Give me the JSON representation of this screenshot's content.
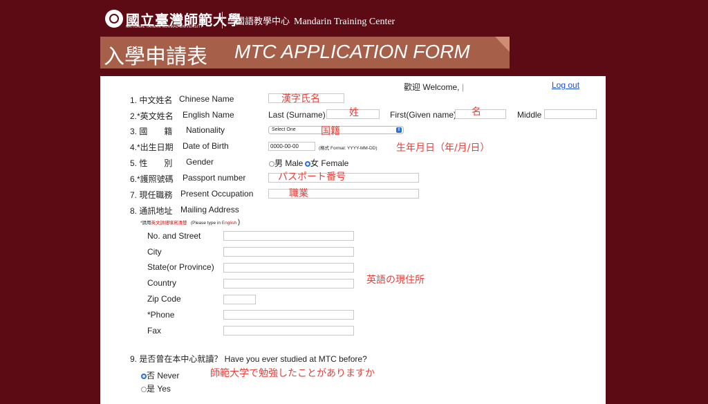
{
  "header": {
    "university_cn": "國立臺灣師範大學",
    "university_en": "NATIONAL TAIWAN NORMAL UNIVERSITY",
    "center_cn": "國語教學中心",
    "center_en": "Mandarin Training Center"
  },
  "banner": {
    "title_cn": "入學申請表",
    "title_en": "MTC APPLICATION FORM"
  },
  "topbar": {
    "welcome": "歡迎 Welcome,",
    "welcome_user": "",
    "logout": "Log out"
  },
  "form": {
    "f1": {
      "label_cn": "1. 中文姓名",
      "label_en": "Chinese Name",
      "value": "",
      "note": "漢字氏名"
    },
    "f2": {
      "label_cn": "2.*英文姓名",
      "label_en": "English Name",
      "last_label": "Last (Surname)",
      "last_value": "",
      "last_note": "姓",
      "first_label": "First(Given name)",
      "first_value": "",
      "first_note": "名",
      "middle_label": "Middle",
      "middle_value": ""
    },
    "f3": {
      "label_cn": "3. 國　　籍",
      "label_en": "Nationality",
      "selected": "Select One",
      "note": "国籍"
    },
    "f4": {
      "label_cn": "4.*出生日期",
      "label_en": "Date of Birth",
      "value": "0000-00-00",
      "format_hint": "(格式 Format: YYYY-MM-DD)",
      "note": "生年月日（年/月/日）"
    },
    "f5": {
      "label_cn": "5. 性　　別",
      "label_en": "Gender",
      "male": "男 Male",
      "female": "女 Female",
      "selected": "female"
    },
    "f6": {
      "label_cn": "6.*護照號碼",
      "label_en": "Passport number",
      "value": "",
      "note": "パスポート番号"
    },
    "f7": {
      "label_cn": "7. 現任職務",
      "label_en": "Present Occupation",
      "value": "",
      "note": "職業"
    },
    "f8": {
      "label_cn": "8. 通訊地址",
      "label_en": "Mailing Address",
      "hint_pre": "*請用",
      "hint_red": "英文詳細填寫清楚",
      "hint_mid": "(Please type in",
      "hint_red_en": "English",
      "hint_end": ")",
      "street": "No. and Street",
      "city": "City",
      "state": "State(or Province)",
      "country": "Country",
      "zip": "Zip Code",
      "phone": "*Phone",
      "fax": "Fax",
      "note": "英語の現住所"
    },
    "f9": {
      "label": "9. 是否曾在本中心就讀？ Have you ever studied at MTC before?",
      "never": "否 Never",
      "yes": "是 Yes",
      "selected": "never",
      "note": "師範大学で勉強したことがありますか"
    }
  },
  "colors": {
    "background": "#5c0a14",
    "banner": "#a65f49",
    "annotation": "#e8403a",
    "link": "#1a4fd6"
  }
}
